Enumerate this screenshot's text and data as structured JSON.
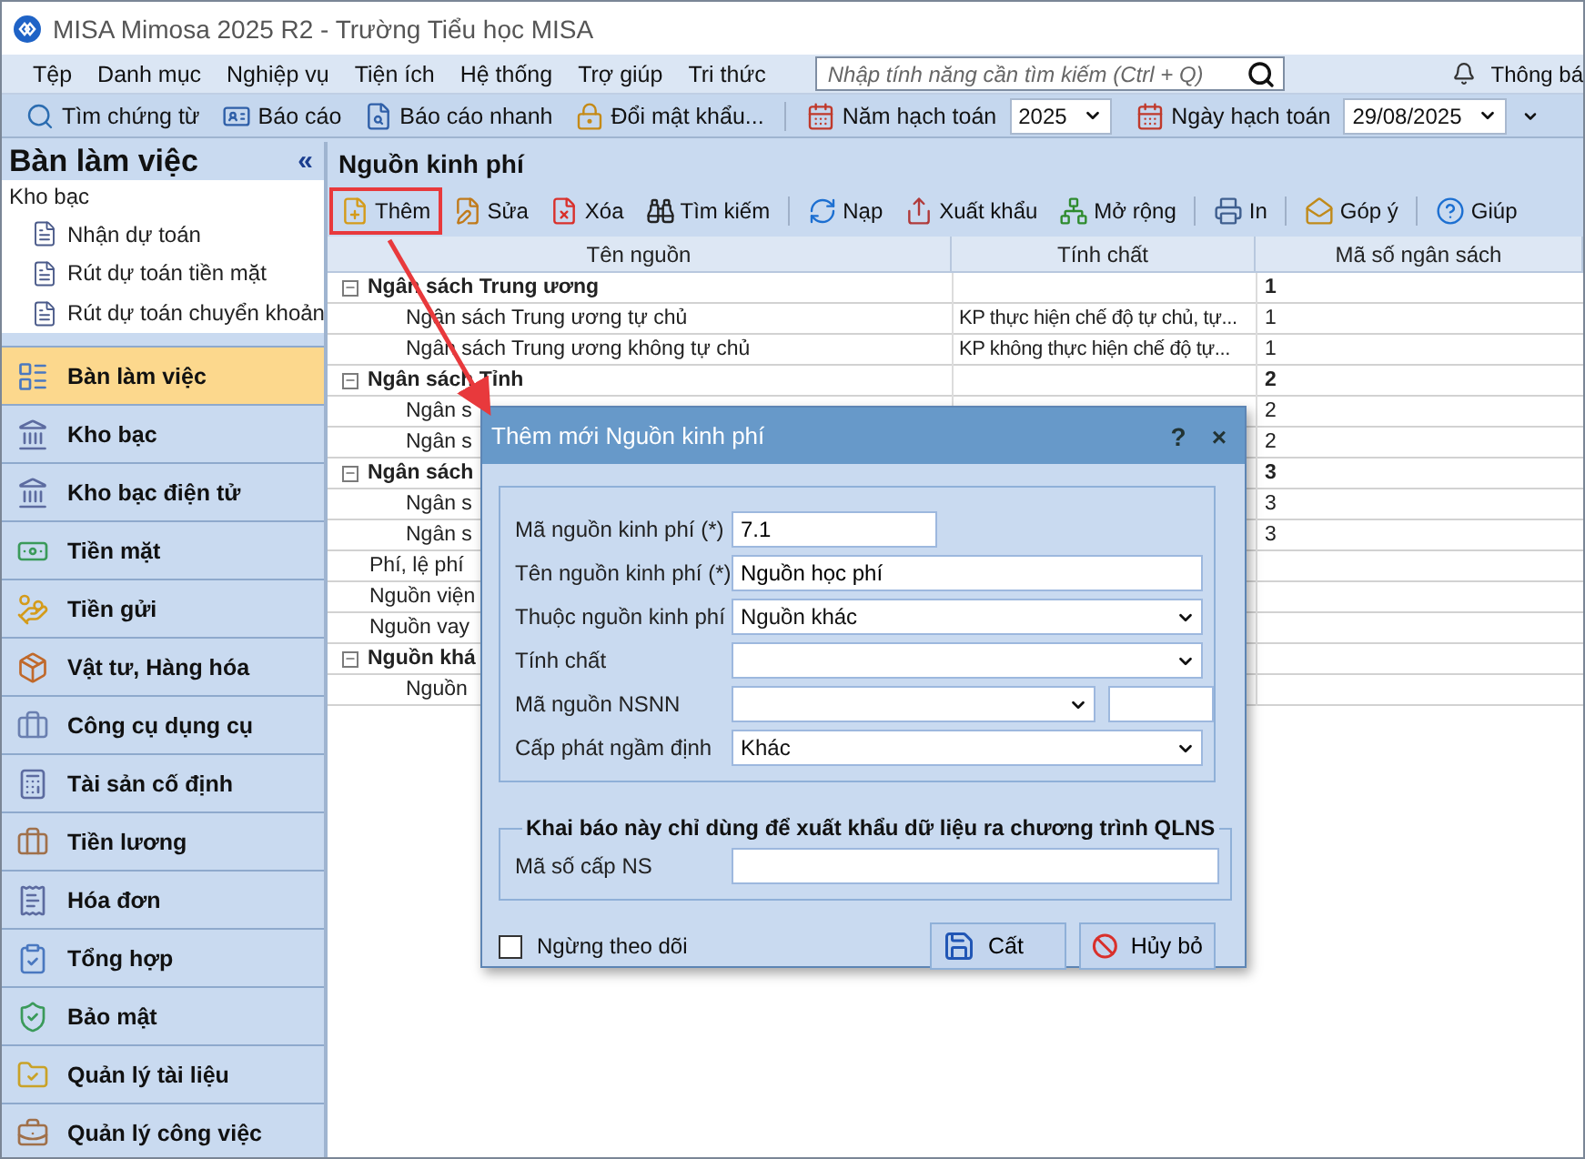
{
  "window": {
    "title": "MISA Mimosa 2025 R2 - Trường Tiểu học MISA"
  },
  "menu": [
    "Tệp",
    "Danh mục",
    "Nghiệp vụ",
    "Tiện ích",
    "Hệ thống",
    "Trợ giúp",
    "Tri thức"
  ],
  "search": {
    "placeholder": "Nhập tính năng cần tìm kiếm (Ctrl + Q)"
  },
  "notification": "Thông bá",
  "toolbar": [
    {
      "kind": "button",
      "label": "Tìm chứng từ"
    },
    {
      "kind": "button",
      "label": "Báo cáo"
    },
    {
      "kind": "button",
      "label": "Báo cáo nhanh"
    },
    {
      "kind": "button",
      "label": "Đổi mật khẩu..."
    },
    {
      "kind": "select",
      "label": "Năm hạch toán",
      "value": "2025"
    },
    {
      "kind": "select",
      "label": "Ngày hạch toán",
      "value": "29/08/2025"
    }
  ],
  "sidebar": {
    "title": "Bàn làm việc",
    "collapse": "«",
    "tree": {
      "group": "Kho bạc",
      "items": [
        "Nhận dự toán",
        "Rút dự toán tiền mặt",
        "Rút dự toán chuyển khoản"
      ]
    },
    "nav": [
      {
        "label": "Bàn làm việc",
        "selected": true
      },
      {
        "label": "Kho bạc",
        "selected": false
      },
      {
        "label": "Kho bạc điện tử",
        "selected": false
      },
      {
        "label": "Tiền mặt",
        "selected": false
      },
      {
        "label": "Tiền gửi",
        "selected": false
      },
      {
        "label": "Vật tư, Hàng hóa",
        "selected": false
      },
      {
        "label": "Công cụ dụng cụ",
        "selected": false
      },
      {
        "label": "Tài sản cố định",
        "selected": false
      },
      {
        "label": "Tiền lương",
        "selected": false
      },
      {
        "label": "Hóa đơn",
        "selected": false
      },
      {
        "label": "Tổng hợp",
        "selected": false
      },
      {
        "label": "Bảo mật",
        "selected": false
      },
      {
        "label": "Quản lý tài liệu",
        "selected": false
      },
      {
        "label": "Quản lý công việc",
        "selected": false
      }
    ]
  },
  "content": {
    "title": "Nguồn kinh phí",
    "toolbar": [
      {
        "label": "Thêm",
        "highlighted": true
      },
      {
        "label": "Sửa",
        "highlighted": false
      },
      {
        "label": "Xóa",
        "highlighted": false
      },
      {
        "label": "Tìm kiếm",
        "highlighted": false
      },
      {
        "label": "Nạp",
        "highlighted": false
      },
      {
        "label": "Xuất khẩu",
        "highlighted": false
      },
      {
        "label": "Mở rộng",
        "highlighted": false
      },
      {
        "label": "In",
        "highlighted": false
      },
      {
        "label": "Góp ý",
        "highlighted": false
      },
      {
        "label": "Giúp",
        "highlighted": false
      }
    ],
    "table": {
      "columns": [
        "Tên nguồn",
        "Tính chất",
        "Mã số ngân sách"
      ],
      "rows": [
        {
          "kind": "group",
          "expanded": true,
          "name": "Ngân sách Trung ương",
          "code": "1"
        },
        {
          "kind": "child",
          "name": "Ngân sách Trung ương tự chủ",
          "property": "KP thực hiện chế độ tự chủ, tự...",
          "code": "1"
        },
        {
          "kind": "child",
          "name": "Ngân sách Trung ương không tự chủ",
          "property": "KP không thực hiện chế độ tự...",
          "code": "1"
        },
        {
          "kind": "group",
          "expanded": true,
          "name": "Ngân sách Tỉnh",
          "code": "2"
        },
        {
          "kind": "child",
          "name": "Ngân s",
          "code": "2"
        },
        {
          "kind": "child",
          "name": "Ngân s",
          "code": "2"
        },
        {
          "kind": "group",
          "expanded": true,
          "name": "Ngân sách",
          "code": "3"
        },
        {
          "kind": "child",
          "name": "Ngân s",
          "code": "3"
        },
        {
          "kind": "child",
          "name": "Ngân s",
          "code": "3"
        },
        {
          "kind": "leaf",
          "name": "Phí, lệ phí"
        },
        {
          "kind": "leaf",
          "name": "Nguồn viện"
        },
        {
          "kind": "leaf",
          "name": "Nguồn vay"
        },
        {
          "kind": "group",
          "expanded": true,
          "name": "Nguồn khá"
        },
        {
          "kind": "child",
          "name": "Nguồn"
        }
      ]
    }
  },
  "dialog": {
    "title": "Thêm mới Nguồn kinh phí",
    "help": "?",
    "close": "×",
    "fields": [
      {
        "kind": "text",
        "label": "Mã nguồn kinh phí (*)",
        "value": "7.1"
      },
      {
        "kind": "text_wide",
        "label": "Tên nguồn kinh phí (*)",
        "value": "Nguồn học phí"
      },
      {
        "kind": "select",
        "label": "Thuộc nguồn kinh phí",
        "value": "Nguồn khác"
      },
      {
        "kind": "select",
        "label": "Tính chất"
      },
      {
        "kind": "select_pair",
        "label": "Mã nguồn NSNN"
      },
      {
        "kind": "select",
        "label": "Cấp phát ngầm định",
        "value": "Khác"
      }
    ],
    "export_group": {
      "legend": "Khai báo này chỉ dùng để xuất khẩu dữ liệu ra chương trình QLNS",
      "fields": [
        {
          "kind": "text_wide",
          "label": "Mã số cấp NS"
        }
      ]
    },
    "stop_tracking": {
      "label": "Ngừng theo dõi",
      "checked": false
    },
    "buttons": [
      "Cất",
      "Hủy bỏ"
    ]
  }
}
